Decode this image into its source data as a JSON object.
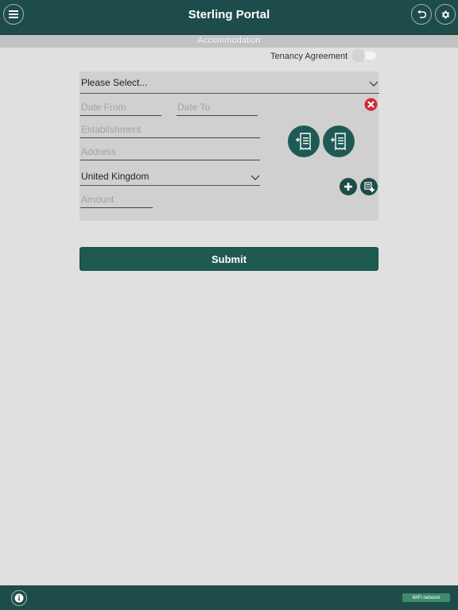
{
  "app": {
    "title": "Sterling Portal"
  },
  "section": {
    "title": "Accommodation"
  },
  "tenancy": {
    "label": "Tenancy Agreement",
    "enabled": false
  },
  "form": {
    "type_select": "Please Select...",
    "date_from_placeholder": "Date From",
    "date_to_placeholder": "Date To",
    "establishment_placeholder": "Establishment",
    "address_placeholder": "Address",
    "country": "United Kingdom",
    "amount_placeholder": "Amount"
  },
  "submit": {
    "label": "Submit"
  },
  "footer": {
    "network": "WiFi network"
  },
  "colors": {
    "primary": "#1e4c4a",
    "accent": "#1e5a50",
    "background": "#dfe0df",
    "remove": "#d0283a"
  },
  "icons": [
    "menu-icon",
    "undo-icon",
    "gear-icon",
    "remove-icon",
    "add-receipt-icon",
    "add-icon",
    "add-list-icon",
    "info-icon"
  ]
}
